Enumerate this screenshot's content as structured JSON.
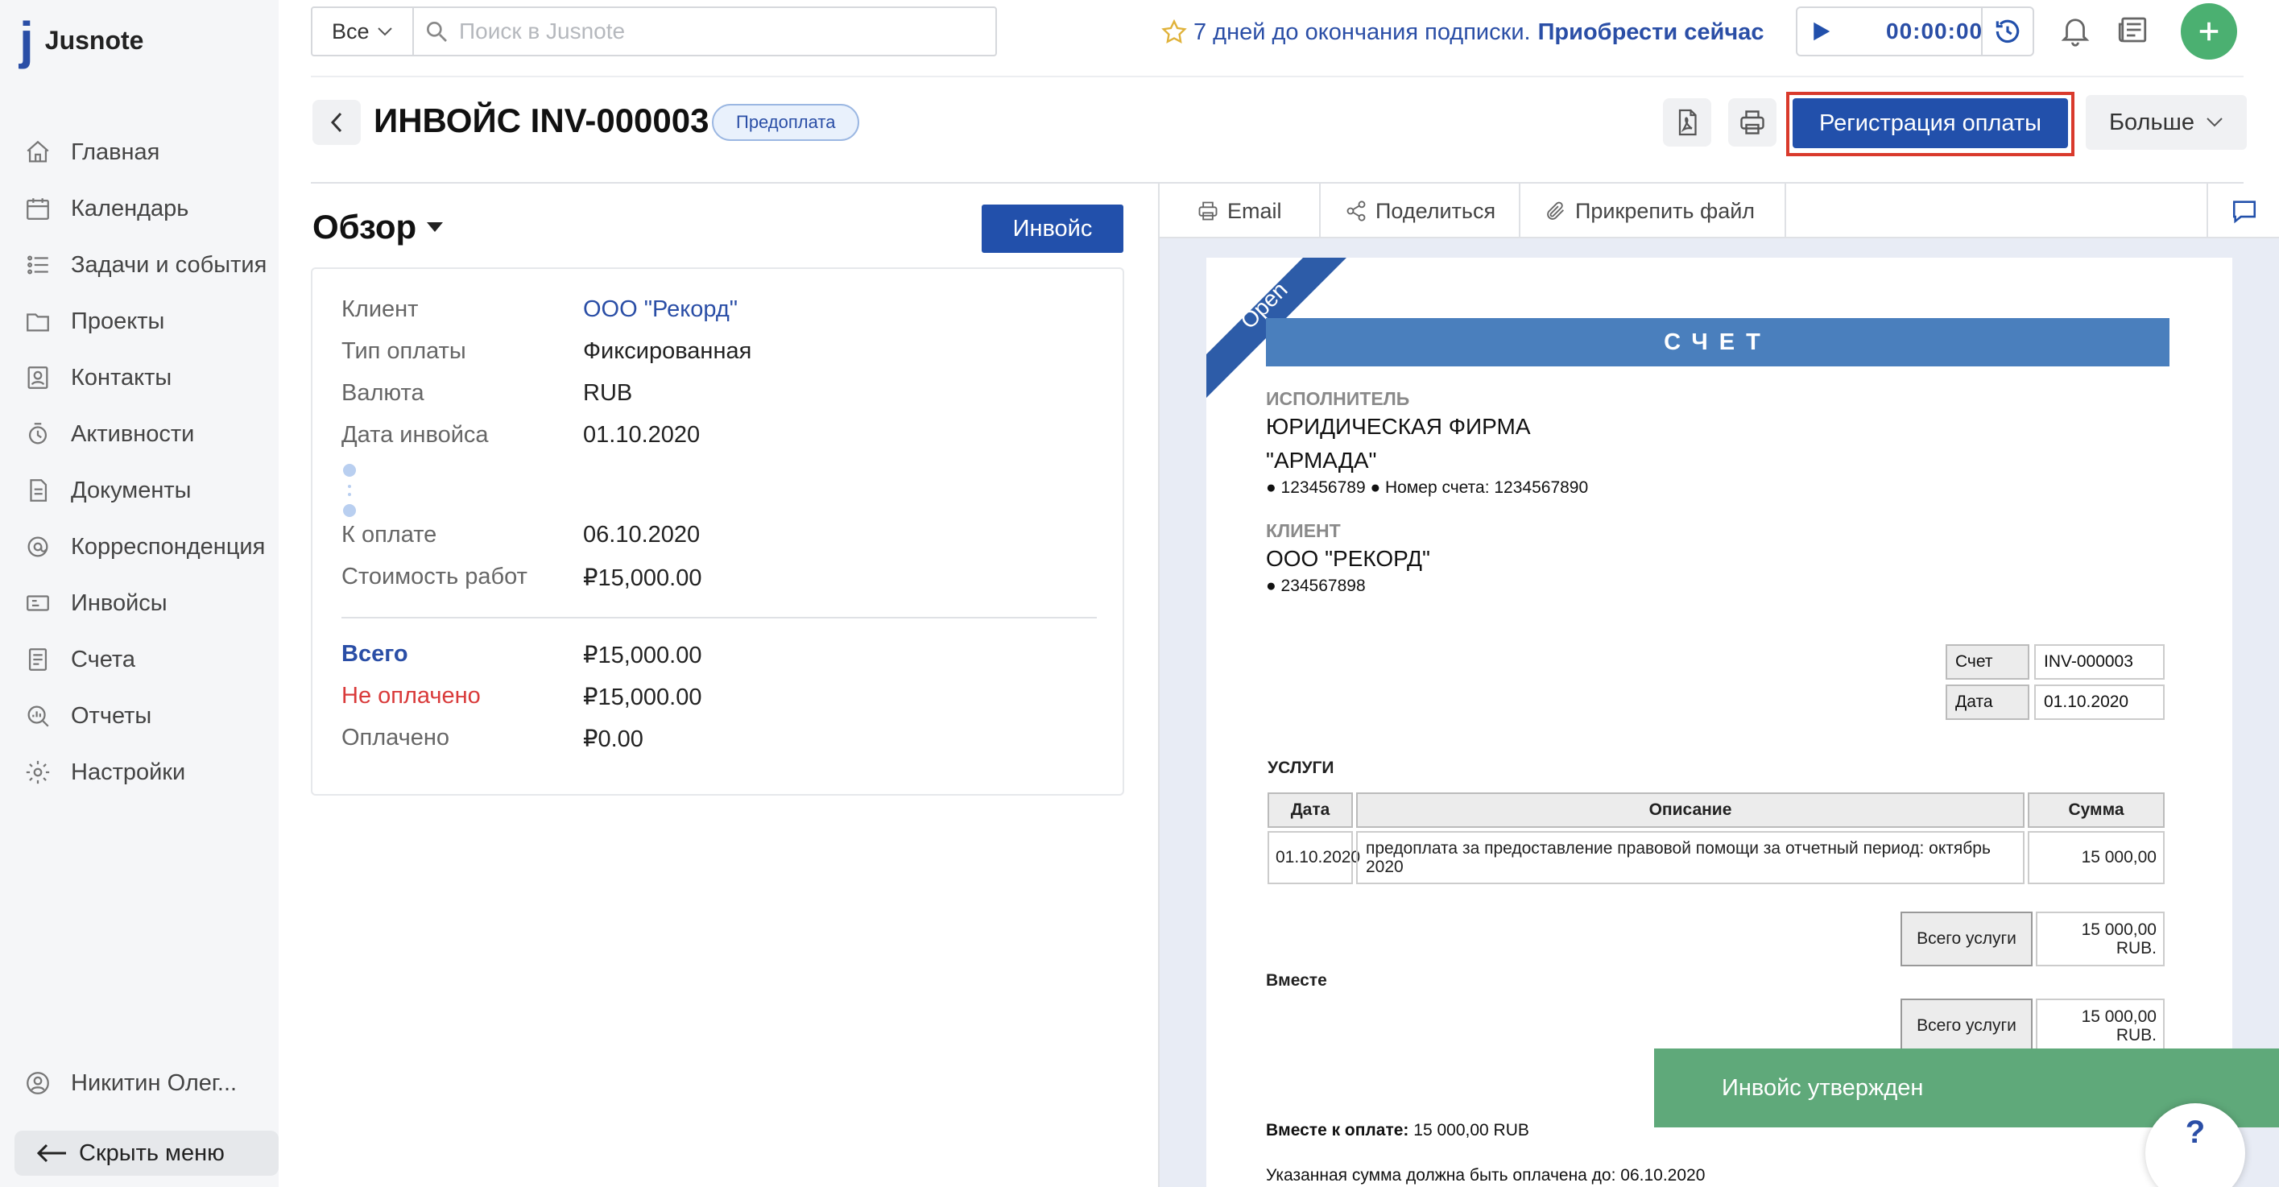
{
  "brand": {
    "name": "Jusnote",
    "mark": "j"
  },
  "nav": [
    {
      "label": "Главная",
      "icon": "home-icon"
    },
    {
      "label": "Календарь",
      "icon": "calendar-icon"
    },
    {
      "label": "Задачи и события",
      "icon": "tasks-icon"
    },
    {
      "label": "Проекты",
      "icon": "projects-icon"
    },
    {
      "label": "Контакты",
      "icon": "contacts-icon"
    },
    {
      "label": "Активности",
      "icon": "activity-icon"
    },
    {
      "label": "Документы",
      "icon": "documents-icon"
    },
    {
      "label": "Корреспонденция",
      "icon": "mail-icon"
    },
    {
      "label": "Инвойсы",
      "icon": "invoice-icon"
    },
    {
      "label": "Счета",
      "icon": "bills-icon"
    },
    {
      "label": "Отчеты",
      "icon": "reports-icon"
    },
    {
      "label": "Настройки",
      "icon": "gear-icon"
    }
  ],
  "user": {
    "name": "Никитин Олег..."
  },
  "hide_menu_label": "Скрыть меню",
  "search": {
    "scope": "Все",
    "placeholder": "Поиск в Jusnote",
    "value": ""
  },
  "promo": {
    "text": "7 дней до окончания подписки.",
    "link": "Приобрести сейчас"
  },
  "timer": {
    "time": "00:00:00"
  },
  "header": {
    "title": "ИНВОЙС INV-000003",
    "badge": "Предоплата",
    "pay_button": "Регистрация оплаты",
    "more_button": "Больше"
  },
  "overview": {
    "title": "Обзор",
    "tab": "Инвойс",
    "rows": [
      {
        "label": "Клиент",
        "value": "ООО \"Рекорд\""
      },
      {
        "label": "Тип оплаты",
        "value": "Фиксированная"
      },
      {
        "label": "Валюта",
        "value": "RUB"
      },
      {
        "label": "Дата инвойса",
        "value": "01.10.2020"
      },
      {
        "label": "К оплате",
        "value": "06.10.2020"
      },
      {
        "label": "Стоимость работ",
        "value": "₽15,000.00"
      }
    ],
    "totals": [
      {
        "label": "Всего",
        "value": "₽15,000.00"
      },
      {
        "label": "Не оплачено",
        "value": "₽15,000.00"
      },
      {
        "label": "Оплачено",
        "value": "₽0.00"
      }
    ]
  },
  "toolbar": {
    "email": "Email",
    "share": "Поделиться",
    "attach": "Прикрепить файл"
  },
  "invoice_doc": {
    "ribbon": "Open",
    "title": "СЧЕТ",
    "executor_label": "ИСПОЛНИТЕЛЬ",
    "executor_line1": "ЮРИДИЧЕСКАЯ ФИРМА",
    "executor_line2": "\"АРМАДА\"",
    "executor_details": "● 123456789 ● Номер счета: 1234567890",
    "client_label": "КЛИЕНТ",
    "client_name": "ООО \"РЕКОРД\"",
    "client_details": "● 234567898",
    "meta": [
      {
        "label": "Счет",
        "value": "INV-000003"
      },
      {
        "label": "Дата",
        "value": "01.10.2020"
      }
    ],
    "services_label": "УСЛУГИ",
    "columns": [
      "Дата",
      "Описание",
      "Сумма"
    ],
    "service_row": {
      "date": "01.10.2020",
      "description": "предоплата за предоставление правовой помощи за отчетный период: октябрь 2020",
      "amount": "15 000,00"
    },
    "total_label": "Всего услуги",
    "total_value": "15 000,00 RUB.",
    "together_label": "Вместе",
    "together_total_label": "Всего услуги",
    "together_total_value": "15 000,00 RUB.",
    "due_label": "Вместе к оплате:",
    "due_value": "15 000,00 RUB",
    "footer_note": "Указанная сумма должна быть оплачена до: 06.10.2020"
  },
  "toast": "Инвойс утвержден",
  "help": "?",
  "colors": {
    "accent": "#2250ab",
    "success": "#4bb071",
    "highlight": "#d93a2c",
    "danger": "#d93a3a"
  }
}
